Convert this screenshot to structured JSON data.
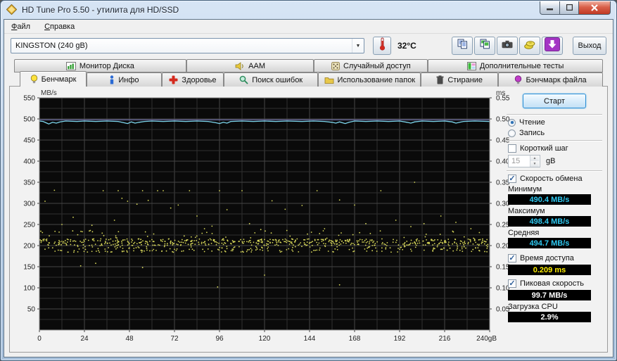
{
  "window": {
    "title": "HD Tune Pro 5.50 - утилита для HD/SSD"
  },
  "menu": {
    "items": [
      {
        "label": "Файл"
      },
      {
        "label": "Справка"
      }
    ]
  },
  "toolbar": {
    "drive_select": "KINGSTON (240 gB)",
    "temperature": "32°C",
    "exit_label": "Выход"
  },
  "tabs": {
    "row1": [
      {
        "label": "Монитор Диска",
        "icon": "disk-monitor-icon"
      },
      {
        "label": "AAM",
        "icon": "speaker-icon"
      },
      {
        "label": "Случайный доступ",
        "icon": "dice-icon"
      },
      {
        "label": "Дополнительные  тесты",
        "icon": "extra-tests-icon"
      }
    ],
    "row2": [
      {
        "label": "Бенчмарк",
        "icon": "bulb-yellow-icon",
        "active": true
      },
      {
        "label": "Инфо",
        "icon": "info-icon"
      },
      {
        "label": "Здоровье",
        "icon": "health-cross-icon"
      },
      {
        "label": "Поиск ошибок",
        "icon": "magnifier-icon"
      },
      {
        "label": "Использование папок",
        "icon": "folder-icon"
      },
      {
        "label": "Стирание",
        "icon": "trash-icon"
      },
      {
        "label": "Бэнчмарк файла",
        "icon": "bulb-purple-icon"
      }
    ]
  },
  "panel": {
    "start_button": "Старт",
    "radio_read": "Чтение",
    "radio_write": "Запись",
    "short_stride_label": "Короткий шаг",
    "stride_value": "15",
    "stride_unit": "gB",
    "transfer_rate_label": "Скорость обмена",
    "minimum_label": "Минимум",
    "minimum_value": "490.4 MB/s",
    "maximum_label": "Максимум",
    "maximum_value": "498.4 MB/s",
    "average_label": "Средняя",
    "average_value": "494.7 MB/s",
    "access_time_label": "Время доступа",
    "access_time_value": "0.209 ms",
    "burst_rate_label": "Пиковая скорость",
    "burst_rate_value": "99.7 MB/s",
    "cpu_usage_label": "Загрузка CPU",
    "cpu_usage_value": "2.9%"
  },
  "chart_data": {
    "type": "line+scatter",
    "background": "#0a0a0a",
    "grid_major_color": "#454545",
    "grid_minor_color": "#303030",
    "border_color": "#8d8d8d",
    "x_axis": {
      "min": 0,
      "max": 240,
      "tick_step": 24,
      "grid_step": 12,
      "tick_labels": [
        "0",
        "24",
        "48",
        "72",
        "96",
        "120",
        "144",
        "168",
        "192",
        "216",
        "240gB"
      ]
    },
    "y_left": {
      "label": "MB/s",
      "min": 0,
      "max": 550,
      "tick_step": 50,
      "grid_step": 25,
      "tick_labels": [
        "50",
        "100",
        "150",
        "200",
        "250",
        "300",
        "350",
        "400",
        "450",
        "500",
        "550"
      ]
    },
    "y_right": {
      "label": "ms",
      "min": 0,
      "max": 0.55,
      "tick_step": 0.05,
      "tick_labels": [
        "0.05",
        "0.10",
        "0.15",
        "0.20",
        "0.25",
        "0.30",
        "0.35",
        "0.40",
        "0.45",
        "0.50",
        "0.55"
      ]
    },
    "series": [
      {
        "name": "transfer-rate-reference",
        "axis": "left",
        "color": "#8080c2",
        "width": 1,
        "const_y": 498
      },
      {
        "name": "transfer-rate",
        "axis": "left",
        "color": "#7fd8f0",
        "width": 1.3,
        "points": [
          [
            0,
            495
          ],
          [
            2,
            494
          ],
          [
            4,
            490
          ],
          [
            5,
            488
          ],
          [
            7,
            492
          ],
          [
            9,
            490
          ],
          [
            11,
            493
          ],
          [
            14,
            495
          ],
          [
            20,
            494
          ],
          [
            24,
            495
          ],
          [
            30,
            494
          ],
          [
            36,
            495
          ],
          [
            42,
            494
          ],
          [
            45,
            491
          ],
          [
            47,
            489
          ],
          [
            49,
            493
          ],
          [
            51,
            490
          ],
          [
            53,
            492
          ],
          [
            56,
            494
          ],
          [
            60,
            495
          ],
          [
            66,
            494
          ],
          [
            72,
            495
          ],
          [
            78,
            494
          ],
          [
            84,
            495
          ],
          [
            90,
            494
          ],
          [
            94,
            491
          ],
          [
            96,
            489
          ],
          [
            98,
            492
          ],
          [
            100,
            490
          ],
          [
            102,
            494
          ],
          [
            108,
            495
          ],
          [
            114,
            494
          ],
          [
            120,
            495
          ],
          [
            126,
            494
          ],
          [
            132,
            495
          ],
          [
            140,
            494
          ],
          [
            146,
            495
          ],
          [
            152,
            494
          ],
          [
            156,
            492
          ],
          [
            158,
            490
          ],
          [
            160,
            493
          ],
          [
            163,
            489
          ],
          [
            165,
            492
          ],
          [
            168,
            495
          ],
          [
            174,
            494
          ],
          [
            180,
            495
          ],
          [
            186,
            494
          ],
          [
            192,
            495
          ],
          [
            196,
            492
          ],
          [
            198,
            490
          ],
          [
            200,
            493
          ],
          [
            204,
            495
          ],
          [
            210,
            494
          ],
          [
            216,
            495
          ],
          [
            220,
            493
          ],
          [
            222,
            490
          ],
          [
            224,
            492
          ],
          [
            226,
            494
          ],
          [
            232,
            495
          ],
          [
            240,
            494
          ]
        ]
      },
      {
        "name": "access-time",
        "axis": "right",
        "color": "#d8d85a",
        "dot_radius": 0.9,
        "bands": [
          {
            "y_min": 0.2,
            "y_max": 0.216,
            "count": 520
          },
          {
            "y_min": 0.184,
            "y_max": 0.198,
            "count": 210
          },
          {
            "y_min": 0.217,
            "y_max": 0.236,
            "count": 55
          }
        ],
        "outliers": [
          [
            3,
            0.305
          ],
          [
            8,
            0.331
          ],
          [
            12,
            0.25
          ],
          [
            18,
            0.267
          ],
          [
            22,
            0.152
          ],
          [
            28,
            0.248
          ],
          [
            30,
            0.158
          ],
          [
            34,
            0.33
          ],
          [
            40,
            0.26
          ],
          [
            42,
            0.33
          ],
          [
            44,
            0.312
          ],
          [
            47,
            0.305
          ],
          [
            52,
            0.298
          ],
          [
            55,
            0.148
          ],
          [
            55,
            0.33
          ],
          [
            58,
            0.307
          ],
          [
            63,
            0.33
          ],
          [
            66,
            0.33
          ],
          [
            70,
            0.289
          ],
          [
            74,
            0.296
          ],
          [
            80,
            0.33
          ],
          [
            84,
            0.27
          ],
          [
            88,
            0.24
          ],
          [
            92,
            0.246
          ],
          [
            95,
            0.102
          ],
          [
            96,
            0.33
          ],
          [
            100,
            0.285
          ],
          [
            108,
            0.33
          ],
          [
            112,
            0.252
          ],
          [
            118,
            0.238
          ],
          [
            120,
            0.13
          ],
          [
            124,
            0.306
          ],
          [
            131,
            0.286
          ],
          [
            140,
            0.295
          ],
          [
            148,
            0.33
          ],
          [
            152,
            0.24
          ],
          [
            160,
            0.107
          ],
          [
            160,
            0.308
          ],
          [
            168,
            0.296
          ],
          [
            174,
            0.252
          ],
          [
            182,
            0.33
          ],
          [
            190,
            0.26
          ],
          [
            198,
            0.245
          ],
          [
            200,
            0.35
          ],
          [
            205,
            0.252
          ],
          [
            214,
            0.27
          ],
          [
            222,
            0.255
          ],
          [
            230,
            0.24
          ]
        ]
      }
    ]
  }
}
